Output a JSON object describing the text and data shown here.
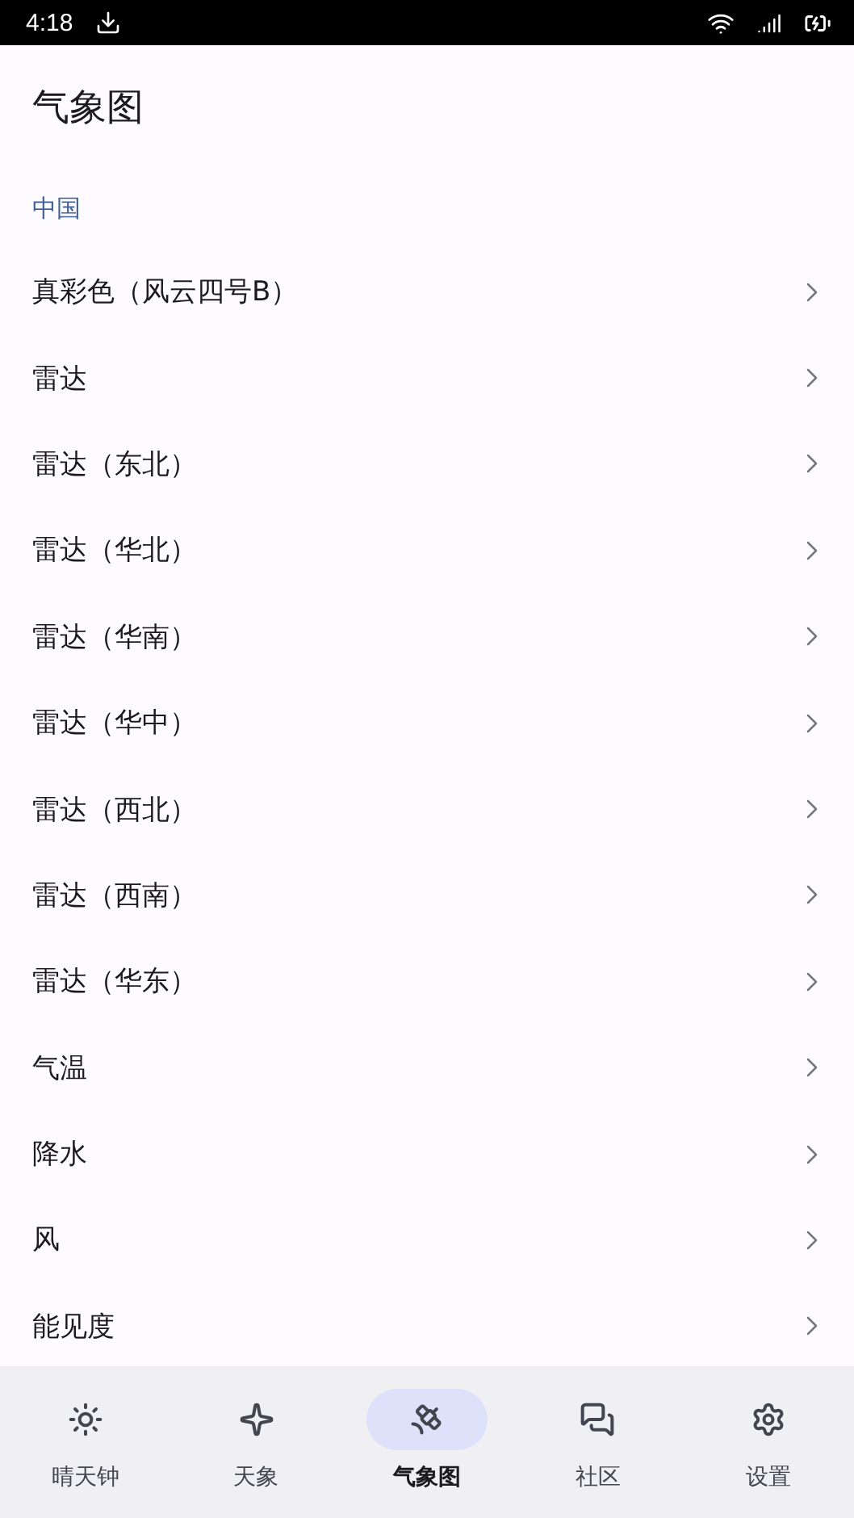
{
  "status_bar": {
    "time": "4:18"
  },
  "header": {
    "title": "气象图"
  },
  "section": {
    "label": "中国"
  },
  "items": [
    {
      "label": "真彩色（风云四号B）"
    },
    {
      "label": "雷达"
    },
    {
      "label": "雷达（东北）"
    },
    {
      "label": "雷达（华北）"
    },
    {
      "label": "雷达（华南）"
    },
    {
      "label": "雷达（华中）"
    },
    {
      "label": "雷达（西北）"
    },
    {
      "label": "雷达（西南）"
    },
    {
      "label": "雷达（华东）"
    },
    {
      "label": "气温"
    },
    {
      "label": "降水"
    },
    {
      "label": "风"
    },
    {
      "label": "能见度"
    }
  ],
  "nav": [
    {
      "kind": "sun",
      "label": "晴天钟",
      "selected": false
    },
    {
      "kind": "star",
      "label": "天象",
      "selected": false
    },
    {
      "kind": "satellite",
      "label": "气象图",
      "selected": true
    },
    {
      "kind": "chat",
      "label": "社区",
      "selected": false
    },
    {
      "kind": "gear",
      "label": "设置",
      "selected": false
    }
  ]
}
